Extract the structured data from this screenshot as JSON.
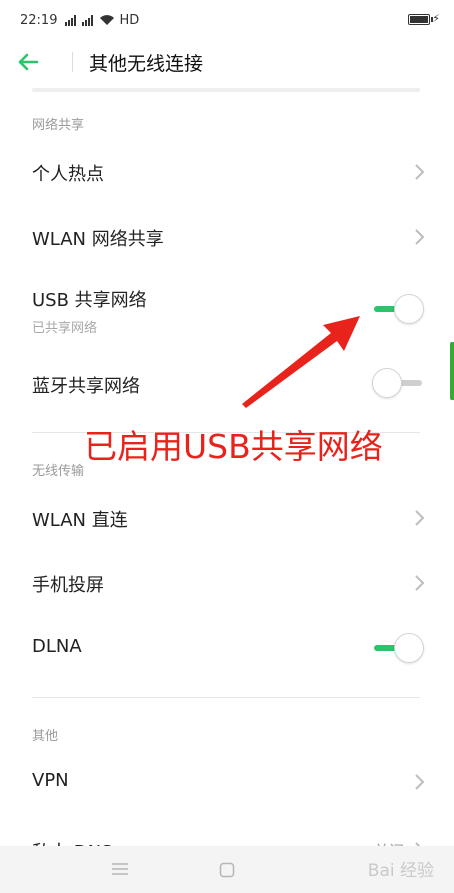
{
  "status_bar": {
    "time": "22:19",
    "network": "HD"
  },
  "app_bar": {
    "title": "其他无线连接"
  },
  "sections": {
    "sharing": "网络共享",
    "wireless": "无线传输",
    "other": "其他"
  },
  "rows": {
    "hotspot": "个人热点",
    "wlan_sharing": "WLAN 网络共享",
    "usb_sharing": "USB 共享网络",
    "usb_sharing_sub": "已共享网络",
    "bt_sharing": "蓝牙共享网络",
    "wlan_direct": "WLAN 直连",
    "screen_cast": "手机投屏",
    "dlna": "DLNA",
    "vpn": "VPN",
    "private_dns": "私人 DNS",
    "private_dns_value": "关闭"
  },
  "toggles": {
    "usb_sharing": true,
    "bt_sharing": false,
    "dlna": true
  },
  "annotation": "已启用USB共享网络",
  "watermark": "Bai 经验",
  "colors": {
    "accent": "#2ac46a",
    "annotation": "#e8231b"
  },
  "icons": {
    "back": "arrow-left-icon",
    "row": "chevron-right-icon",
    "nav_menu": "menu-icon",
    "nav_home": "square-icon"
  }
}
